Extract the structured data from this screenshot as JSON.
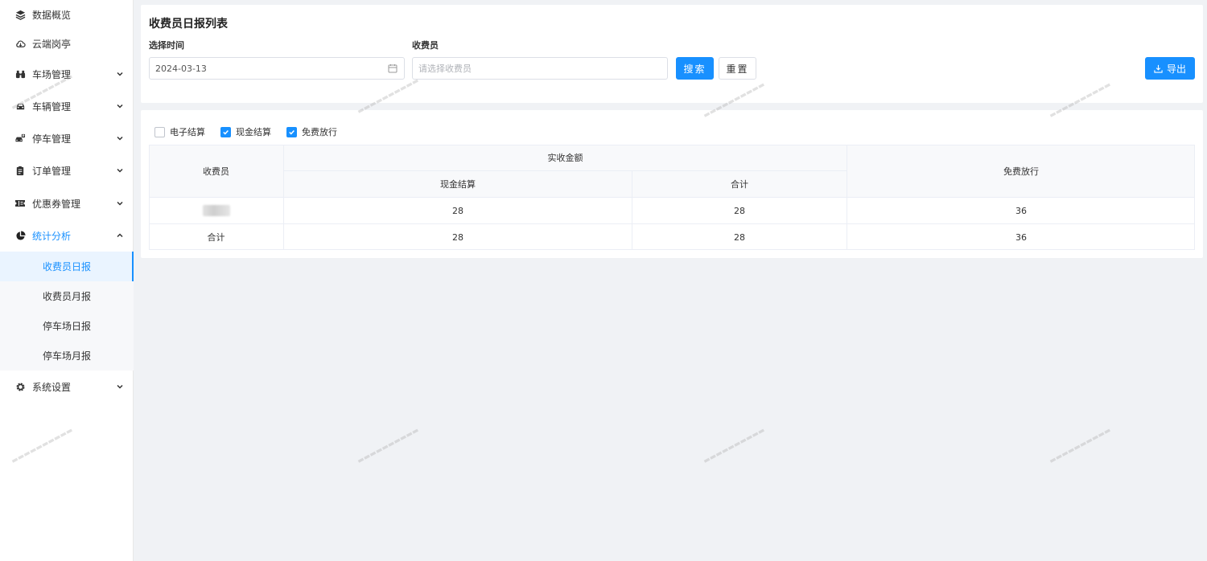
{
  "sidebar": {
    "items": [
      {
        "label": "数据概览",
        "icon": "layers-icon",
        "arrow": ""
      },
      {
        "label": "云端岗亭",
        "icon": "cloud-icon",
        "arrow": ""
      },
      {
        "label": "车场管理",
        "icon": "binoculars-icon",
        "arrow": "down"
      },
      {
        "label": "车辆管理",
        "icon": "car-icon",
        "arrow": "down"
      },
      {
        "label": "停车管理",
        "icon": "parking-car-icon",
        "arrow": "down"
      },
      {
        "label": "订单管理",
        "icon": "clipboard-icon",
        "arrow": "down"
      },
      {
        "label": "优惠券管理",
        "icon": "ticket-icon",
        "arrow": "down"
      },
      {
        "label": "统计分析",
        "icon": "pie-chart-icon",
        "arrow": "up"
      },
      {
        "label": "系统设置",
        "icon": "gear-icon",
        "arrow": "down"
      }
    ],
    "submenu": [
      {
        "label": "收费员日报",
        "active": true
      },
      {
        "label": "收费员月报",
        "active": false
      },
      {
        "label": "停车场日报",
        "active": false
      },
      {
        "label": "停车场月报",
        "active": false
      }
    ]
  },
  "filter": {
    "title": "收费员日报列表",
    "date_label": "选择时间",
    "date_value": "2024-03-13",
    "collector_label": "收费员",
    "collector_placeholder": "请选择收费员",
    "search_label": "搜索",
    "reset_label": "重置",
    "export_label": "导出"
  },
  "toggles": [
    {
      "label": "电子结算",
      "checked": false
    },
    {
      "label": "现金结算",
      "checked": true
    },
    {
      "label": "免费放行",
      "checked": true
    }
  ],
  "table": {
    "col_collector": "收费员",
    "group_actual": "实收金额",
    "col_cash": "现金结算",
    "col_total": "合计",
    "col_free": "免费放行",
    "rows": [
      {
        "collector": "",
        "cash": "28",
        "total": "28",
        "free": "36"
      },
      {
        "collector": "合计",
        "cash": "28",
        "total": "28",
        "free": "36"
      }
    ]
  },
  "colors": {
    "accent": "#1890ff",
    "background": "#f0f2f5"
  }
}
